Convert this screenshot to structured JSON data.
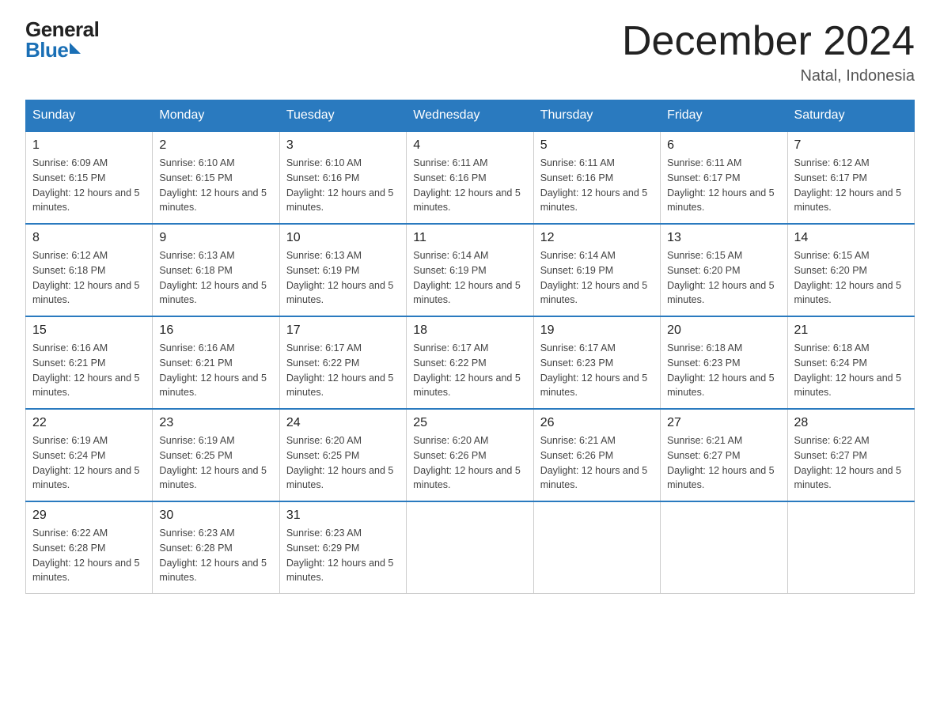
{
  "header": {
    "logo_general": "General",
    "logo_blue": "Blue",
    "month_title": "December 2024",
    "location": "Natal, Indonesia"
  },
  "days_of_week": [
    "Sunday",
    "Monday",
    "Tuesday",
    "Wednesday",
    "Thursday",
    "Friday",
    "Saturday"
  ],
  "weeks": [
    [
      {
        "day": "1",
        "sunrise": "6:09 AM",
        "sunset": "6:15 PM",
        "daylight": "12 hours and 5 minutes."
      },
      {
        "day": "2",
        "sunrise": "6:10 AM",
        "sunset": "6:15 PM",
        "daylight": "12 hours and 5 minutes."
      },
      {
        "day": "3",
        "sunrise": "6:10 AM",
        "sunset": "6:16 PM",
        "daylight": "12 hours and 5 minutes."
      },
      {
        "day": "4",
        "sunrise": "6:11 AM",
        "sunset": "6:16 PM",
        "daylight": "12 hours and 5 minutes."
      },
      {
        "day": "5",
        "sunrise": "6:11 AM",
        "sunset": "6:16 PM",
        "daylight": "12 hours and 5 minutes."
      },
      {
        "day": "6",
        "sunrise": "6:11 AM",
        "sunset": "6:17 PM",
        "daylight": "12 hours and 5 minutes."
      },
      {
        "day": "7",
        "sunrise": "6:12 AM",
        "sunset": "6:17 PM",
        "daylight": "12 hours and 5 minutes."
      }
    ],
    [
      {
        "day": "8",
        "sunrise": "6:12 AM",
        "sunset": "6:18 PM",
        "daylight": "12 hours and 5 minutes."
      },
      {
        "day": "9",
        "sunrise": "6:13 AM",
        "sunset": "6:18 PM",
        "daylight": "12 hours and 5 minutes."
      },
      {
        "day": "10",
        "sunrise": "6:13 AM",
        "sunset": "6:19 PM",
        "daylight": "12 hours and 5 minutes."
      },
      {
        "day": "11",
        "sunrise": "6:14 AM",
        "sunset": "6:19 PM",
        "daylight": "12 hours and 5 minutes."
      },
      {
        "day": "12",
        "sunrise": "6:14 AM",
        "sunset": "6:19 PM",
        "daylight": "12 hours and 5 minutes."
      },
      {
        "day": "13",
        "sunrise": "6:15 AM",
        "sunset": "6:20 PM",
        "daylight": "12 hours and 5 minutes."
      },
      {
        "day": "14",
        "sunrise": "6:15 AM",
        "sunset": "6:20 PM",
        "daylight": "12 hours and 5 minutes."
      }
    ],
    [
      {
        "day": "15",
        "sunrise": "6:16 AM",
        "sunset": "6:21 PM",
        "daylight": "12 hours and 5 minutes."
      },
      {
        "day": "16",
        "sunrise": "6:16 AM",
        "sunset": "6:21 PM",
        "daylight": "12 hours and 5 minutes."
      },
      {
        "day": "17",
        "sunrise": "6:17 AM",
        "sunset": "6:22 PM",
        "daylight": "12 hours and 5 minutes."
      },
      {
        "day": "18",
        "sunrise": "6:17 AM",
        "sunset": "6:22 PM",
        "daylight": "12 hours and 5 minutes."
      },
      {
        "day": "19",
        "sunrise": "6:17 AM",
        "sunset": "6:23 PM",
        "daylight": "12 hours and 5 minutes."
      },
      {
        "day": "20",
        "sunrise": "6:18 AM",
        "sunset": "6:23 PM",
        "daylight": "12 hours and 5 minutes."
      },
      {
        "day": "21",
        "sunrise": "6:18 AM",
        "sunset": "6:24 PM",
        "daylight": "12 hours and 5 minutes."
      }
    ],
    [
      {
        "day": "22",
        "sunrise": "6:19 AM",
        "sunset": "6:24 PM",
        "daylight": "12 hours and 5 minutes."
      },
      {
        "day": "23",
        "sunrise": "6:19 AM",
        "sunset": "6:25 PM",
        "daylight": "12 hours and 5 minutes."
      },
      {
        "day": "24",
        "sunrise": "6:20 AM",
        "sunset": "6:25 PM",
        "daylight": "12 hours and 5 minutes."
      },
      {
        "day": "25",
        "sunrise": "6:20 AM",
        "sunset": "6:26 PM",
        "daylight": "12 hours and 5 minutes."
      },
      {
        "day": "26",
        "sunrise": "6:21 AM",
        "sunset": "6:26 PM",
        "daylight": "12 hours and 5 minutes."
      },
      {
        "day": "27",
        "sunrise": "6:21 AM",
        "sunset": "6:27 PM",
        "daylight": "12 hours and 5 minutes."
      },
      {
        "day": "28",
        "sunrise": "6:22 AM",
        "sunset": "6:27 PM",
        "daylight": "12 hours and 5 minutes."
      }
    ],
    [
      {
        "day": "29",
        "sunrise": "6:22 AM",
        "sunset": "6:28 PM",
        "daylight": "12 hours and 5 minutes."
      },
      {
        "day": "30",
        "sunrise": "6:23 AM",
        "sunset": "6:28 PM",
        "daylight": "12 hours and 5 minutes."
      },
      {
        "day": "31",
        "sunrise": "6:23 AM",
        "sunset": "6:29 PM",
        "daylight": "12 hours and 5 minutes."
      },
      null,
      null,
      null,
      null
    ]
  ]
}
